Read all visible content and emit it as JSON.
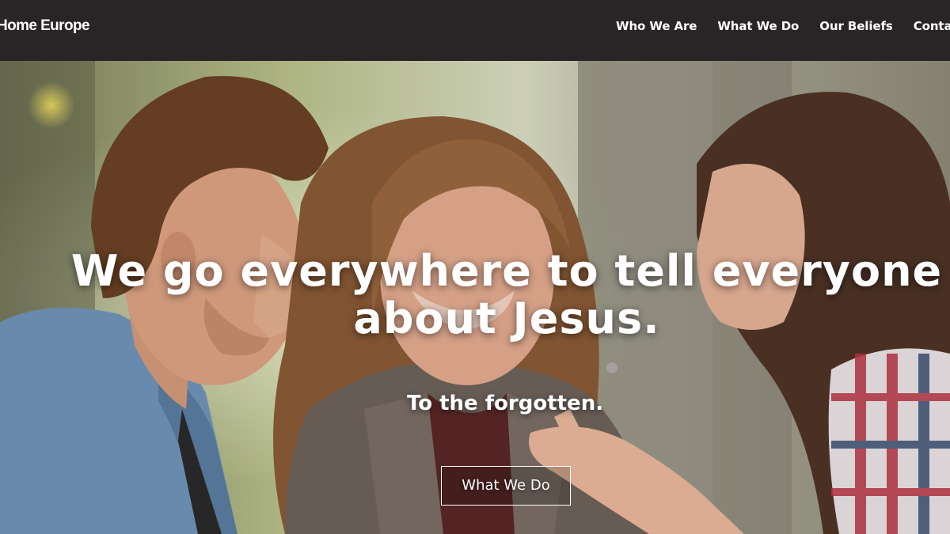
{
  "header": {
    "brand": "Home Europe",
    "nav": [
      {
        "label": "Who We Are"
      },
      {
        "label": "What We Do"
      },
      {
        "label": "Our Beliefs"
      },
      {
        "label": "Contact U"
      }
    ]
  },
  "hero": {
    "headline_line1": "We go everywhere to tell everyone",
    "headline_line2": "about Jesus.",
    "subheadline": "To the forgotten.",
    "cta_label": "What We Do"
  },
  "colors": {
    "navbar_bg": "#292527",
    "text": "#ffffff"
  }
}
